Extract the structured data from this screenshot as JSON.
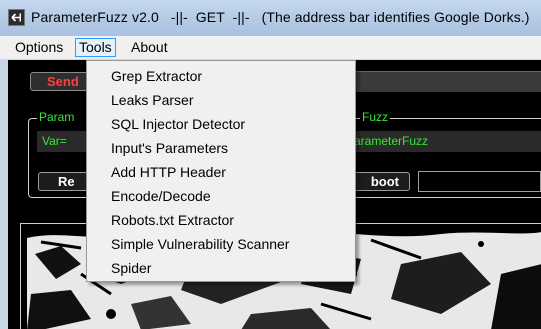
{
  "window": {
    "title": "ParameterFuzz v2.0   -||-  GET  -||-   (The address bar identifies Google Dorks.)"
  },
  "menubar": {
    "items": [
      {
        "label": "Options"
      },
      {
        "label": "Tools"
      },
      {
        "label": "About"
      }
    ]
  },
  "tools_menu": {
    "items": [
      {
        "label": "Grep Extractor"
      },
      {
        "label": "Leaks Parser"
      },
      {
        "label": "SQL Injector Detector"
      },
      {
        "label": "Input's Parameters"
      },
      {
        "label": "Add HTTP Header"
      },
      {
        "label": "Encode/Decode"
      },
      {
        "label": "Robots.txt Extractor"
      },
      {
        "label": "Simple Vulnerability Scanner"
      },
      {
        "label": "Spider"
      }
    ]
  },
  "main": {
    "send_button": "Send",
    "group_legend_left": "Param",
    "group_legend_right": "Fuzz",
    "var_label": "Var=",
    "var_right_text": "arameterFuzz",
    "left_button": "Re",
    "right_button": "boot"
  },
  "colors": {
    "accent_green": "#39e639",
    "send_red": "#ff4040",
    "menu_highlight_border": "#3399ff"
  }
}
